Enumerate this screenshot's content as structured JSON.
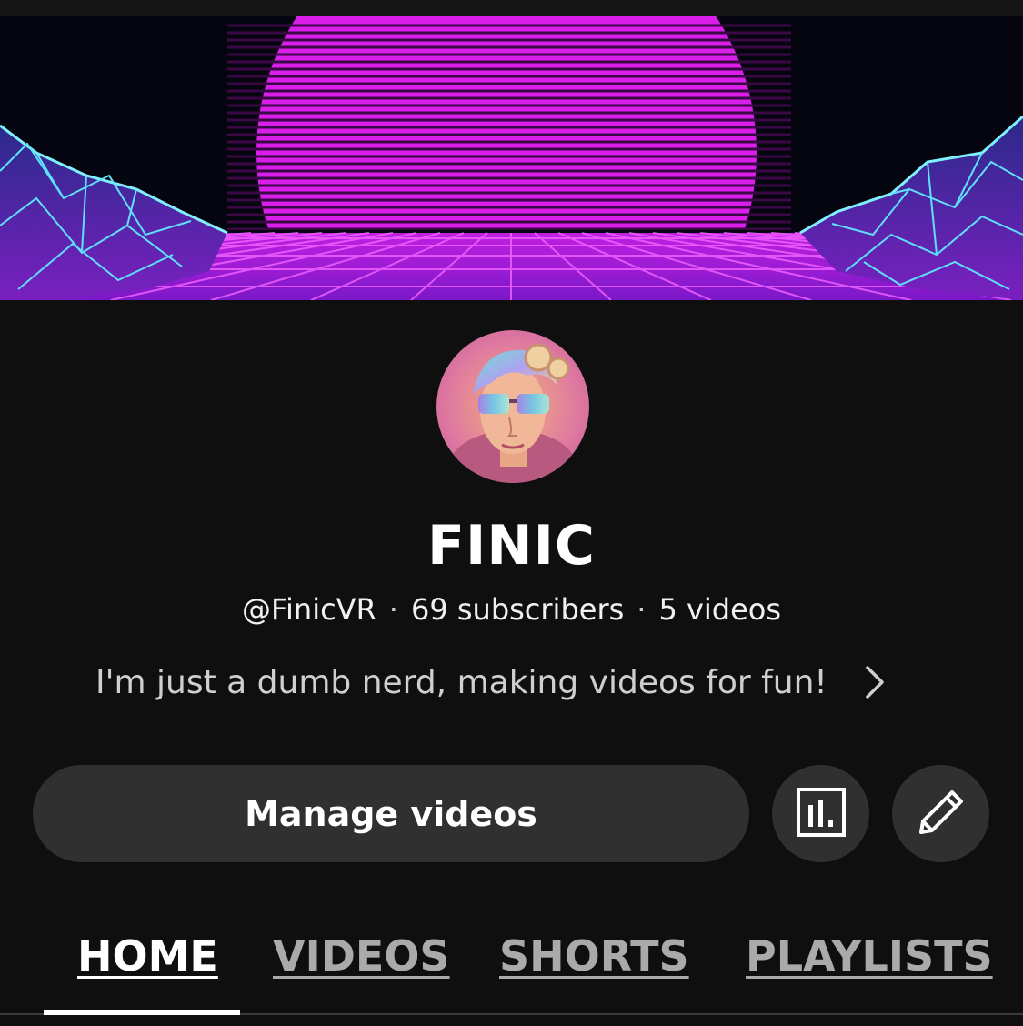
{
  "channel": {
    "name": "FINIC",
    "handle": "@FinicVR",
    "separator": "·",
    "subscribers": "69 subscribers",
    "videos": "5 videos",
    "description": "I'm just a dumb nerd, making videos for fun!"
  },
  "actions": {
    "manage_label": "Manage videos",
    "analytics_icon": "bar-chart-icon",
    "edit_icon": "pencil-icon"
  },
  "tabs": [
    {
      "label": "HOME",
      "active": true
    },
    {
      "label": "VIDEOS",
      "active": false
    },
    {
      "label": "SHORTS",
      "active": false
    },
    {
      "label": "PLAYLISTS",
      "active": false
    }
  ],
  "colors": {
    "background": "#0f0f0f",
    "button": "#303030",
    "banner_sun": "#e020f0",
    "banner_grid": "#60e0ff",
    "inactive_tab": "#aaaaaa"
  }
}
